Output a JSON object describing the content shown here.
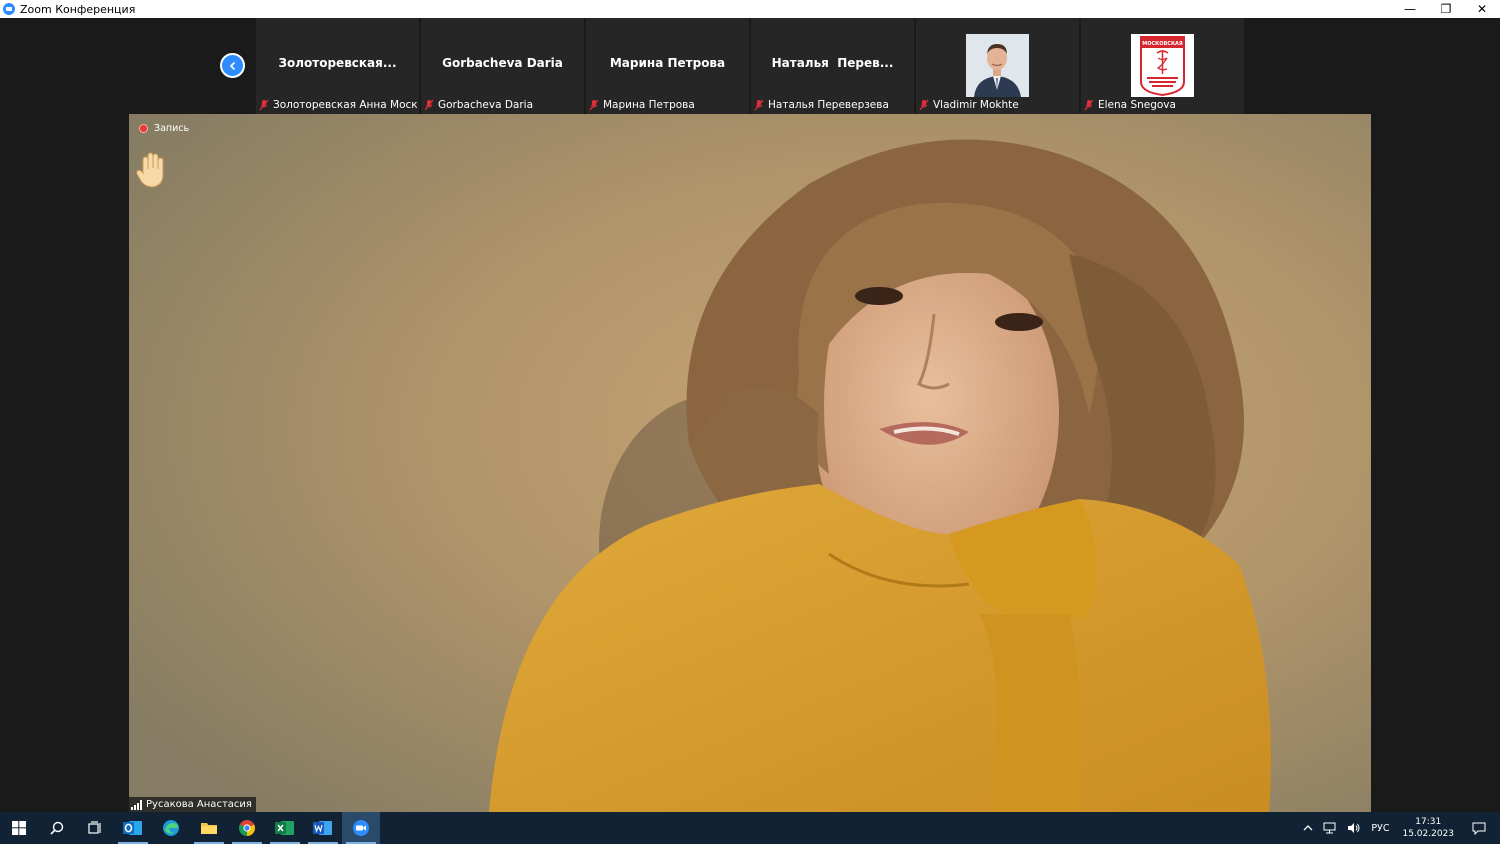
{
  "window": {
    "title": "Zoom Конференция",
    "minimize_glyph": "—",
    "restore_glyph": "❐",
    "close_glyph": "✕",
    "accent": "#2d8cff"
  },
  "strip": {
    "nav_prev_icon": "chevron-left-icon",
    "tiles": [
      {
        "display": "Золоторевская...",
        "label": "Золоторевская Анна Москов..."
      },
      {
        "display": "Gorbacheva Daria",
        "label": "Gorbacheva Daria"
      },
      {
        "display": "Марина Петрова",
        "label": "Марина Петрова"
      },
      {
        "display": "Наталья  Перев...",
        "label": "Наталья Переверзева"
      },
      {
        "display": "",
        "label": "Vladimir Mokhte"
      },
      {
        "display": "",
        "label": "Elena Snegova"
      }
    ],
    "logo_text": "МОСКОВСКАЯ"
  },
  "main": {
    "recording_label": "Запись",
    "speaker_name": "Русакова Анастасия"
  },
  "taskbar": {
    "apps": [
      "windows-start-icon",
      "search-icon",
      "task-view-icon",
      "outlook-icon",
      "edge-icon",
      "file-explorer-icon",
      "chrome-icon",
      "excel-icon",
      "word-icon",
      "zoom-icon"
    ],
    "tray_language": "РУС",
    "time": "17:31",
    "date": "15.02.2023"
  }
}
